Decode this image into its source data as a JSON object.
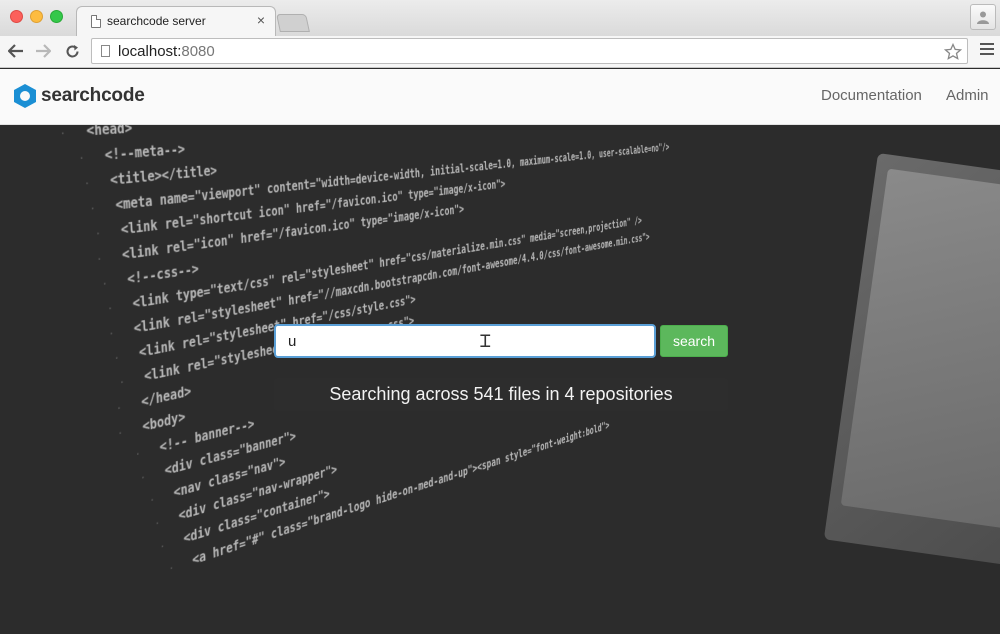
{
  "browser": {
    "tab_title": "searchcode server",
    "tab_close_glyph": "×",
    "url_host": "localhost:",
    "url_port": "8080",
    "icons": {
      "back": "←",
      "forward": "→",
      "reload": "⟳",
      "star": "☆",
      "profile": "👤"
    }
  },
  "header": {
    "logo_text": "searchcode",
    "nav": {
      "documentation": "Documentation",
      "admin": "Admin"
    }
  },
  "search": {
    "value": "u",
    "button_label": "search",
    "status_text": "Searching across 541 files in 4 repositories"
  },
  "background_code": [
    "<head>",
    "<!--meta-->",
    "<title></title>",
    "<meta name=\"viewport\" content=\"width=device-width, initial-scale=1.0, maximum-scale=1.0, user-scalable=no\"/>",
    "<link rel=\"shortcut icon\" href=\"/favicon.ico\" type=\"image/x-icon\">",
    "<link rel=\"icon\" href=\"/favicon.ico\" type=\"image/x-icon\">",
    "<!--css-->",
    "<link type=\"text/css\" rel=\"stylesheet\" href=\"css/materialize.min.css\" media=\"screen,projection\" />",
    "<link rel=\"stylesheet\" href=\"//maxcdn.bootstrapcdn.com/font-awesome/4.4.0/css/font-awesome.min.css\">",
    "<link rel=\"stylesheet\" href=\"/css/style.css\">",
    "<link rel=\"stylesheet\" href=\"css/theme.css\">",
    "</head>",
    "<body>",
    "<!--   banner-->",
    "<div class=\"banner\">",
    "<nav class=\"nav\">",
    "<div class=\"nav-wrapper\">",
    "<div class=\"container\">",
    "<a href=\"#\" class=\"brand-logo hide-on-med-and-up\"><span style=\"font-weight:bold\">"
  ],
  "colors": {
    "accent": "#1b8fd4",
    "search_button": "#5cb85c",
    "input_border": "#5a9fd6"
  }
}
